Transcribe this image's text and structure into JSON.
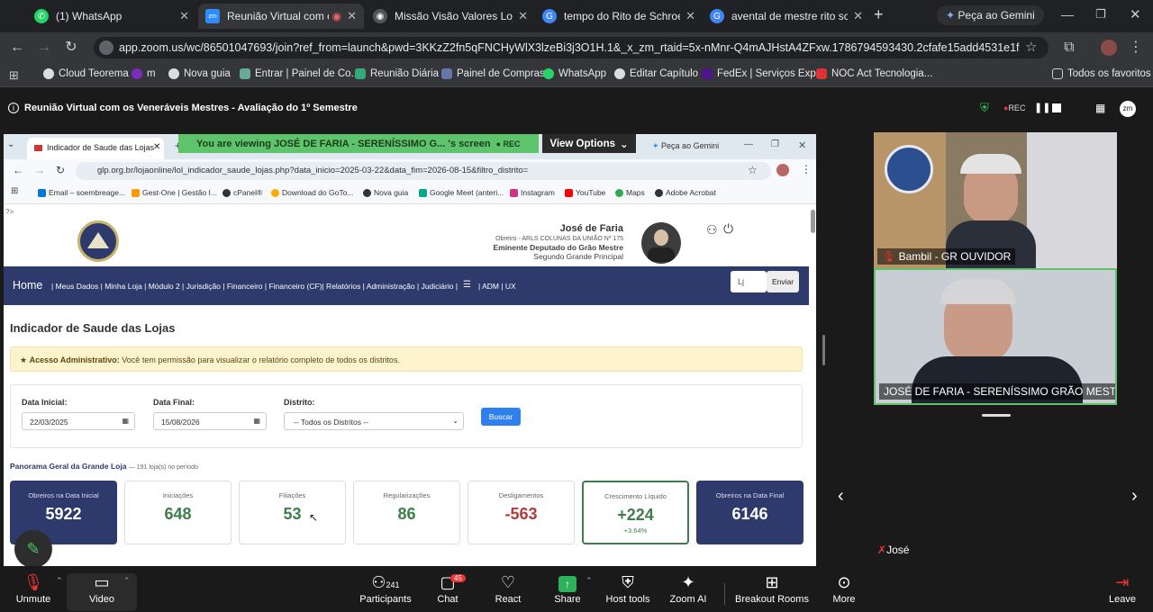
{
  "browser": {
    "tabs": [
      {
        "label": "(1) WhatsApp",
        "color": "#25d366",
        "glyph": "✆"
      },
      {
        "label": "Reunião Virtual com os V",
        "color": "#2d8cff",
        "glyph": "zm"
      },
      {
        "label": "Missão Visão Valores Loja",
        "color": "#555",
        "glyph": "◉"
      },
      {
        "label": "tempo do Rito de Schroeder",
        "color": "#4285f4",
        "glyph": "G"
      },
      {
        "label": "avental de mestre rito schroc",
        "color": "#4285f4",
        "glyph": "G"
      }
    ],
    "new_tab": "+",
    "gemini": "Peça ao Gemini",
    "url": "app.zoom.us/wc/86501047693/join?ref_from=launch&pwd=3KKzZ2fn5qFNCHyWlX3lzeBi3j3O1H.1&_x_zm_rtaid=5x-nMnr-Q4mAJHstA4ZFxw.1786794593430.2cfafe15add4531e1f69ddb4be9e...",
    "bookmarks": [
      "Cloud Teorema",
      "m",
      "Nova guia",
      "Entrar | Painel de Co...",
      "Reunião Diária",
      "Painel de Compras",
      "WhatsApp",
      "Editar Capítulo",
      "FedEx | Serviços Exp...",
      "NOC Act Tecnologia..."
    ],
    "all_favs": "Todos os favoritos"
  },
  "zoom": {
    "meeting_title": "Reunião Virtual com os Veneráveis Mestres - Avaliação do 1º Semestre",
    "rec": "REC",
    "viewing_banner": "You are viewing  JOSÉ DE FARIA - SERENÍSSIMO G...  's screen",
    "view_options": "View Options",
    "participants": [
      {
        "name": "Bambil - GR OUVIDOR"
      },
      {
        "name": "JOSÉ DE FARIA - SERENÍSSIMO GRÃO MESTRE"
      }
    ],
    "self_name": "José",
    "toolbar": {
      "unmute": "Unmute",
      "video": "Video",
      "participants": "Participants",
      "participants_count": "241",
      "chat": "Chat",
      "chat_badge": "45",
      "react": "React",
      "share": "Share",
      "host_tools": "Host tools",
      "zoom_ai": "Zoom AI",
      "breakout": "Breakout Rooms",
      "more": "More",
      "leave": "Leave"
    }
  },
  "shared": {
    "tab_label": "Indicador de Saude das Lojas",
    "gemini": "Peça ao Gemini",
    "url": "glp.org.br/lojaonline/lol_indicador_saude_lojas.php?data_inicio=2025-03-22&data_fim=2026-08-15&filtro_distrito=",
    "bookmarks": [
      "Email – soembreage...",
      "Gest-One | Gestão I...",
      "cPanel®",
      "Download do GoTo...",
      "Nova guia",
      "Google Meet (anteri...",
      "Instagram",
      "YouTube",
      "Maps",
      "Adobe Acrobat"
    ],
    "user": {
      "name": "José de Faria",
      "line1": "Obreiro - ARLS COLUNAS DA UNIÃO Nº 175",
      "line2": "Eminente Deputado do Grão Mestre",
      "line3": "Segundo Grande Principal"
    },
    "nav": {
      "home": "Home",
      "links": "| Meus Dados | Minha Loja | Módulo 2 | Jurisdição | Financeiro | Financeiro (CF)| Relatórios | Administração | Judiciário |",
      "links2": "| ADM | UX",
      "search_value": "Lj",
      "send": "Enviar"
    },
    "page_title": "Indicador de Saude das Lojas",
    "alert_bold": "Acesso Administrativo:",
    "alert_text": "Você tem permissão para visualizar o relatório completo de todos os distritos.",
    "filters": {
      "start_label": "Data Inicial:",
      "start_value": "22/03/2025",
      "end_label": "Data Final:",
      "end_value": "15/08/2026",
      "district_label": "Distrito:",
      "district_value": "-- Todos os Distritos --",
      "search": "Buscar"
    },
    "panorama": "Panorama Geral da Grande Loja",
    "panorama_sub": "— 191 loja(s) no período",
    "cards": [
      {
        "title": "Obreiros na Data Inicial",
        "value": "5922",
        "color": "#ffffff"
      },
      {
        "title": "Iniciações",
        "value": "648",
        "color": "#3f7d4a"
      },
      {
        "title": "Filiações",
        "value": "53",
        "color": "#3f7d4a"
      },
      {
        "title": "Regularizações",
        "value": "86",
        "color": "#3f7d4a"
      },
      {
        "title": "Desligamentos",
        "value": "-563",
        "color": "#b33a3a"
      },
      {
        "title": "Crescimento Líquido",
        "value": "+224",
        "sub": "+3.64%",
        "color": "#3f7d4a"
      },
      {
        "title": "Obreiros na Data Final",
        "value": "6146",
        "color": "#ffffff"
      }
    ]
  }
}
